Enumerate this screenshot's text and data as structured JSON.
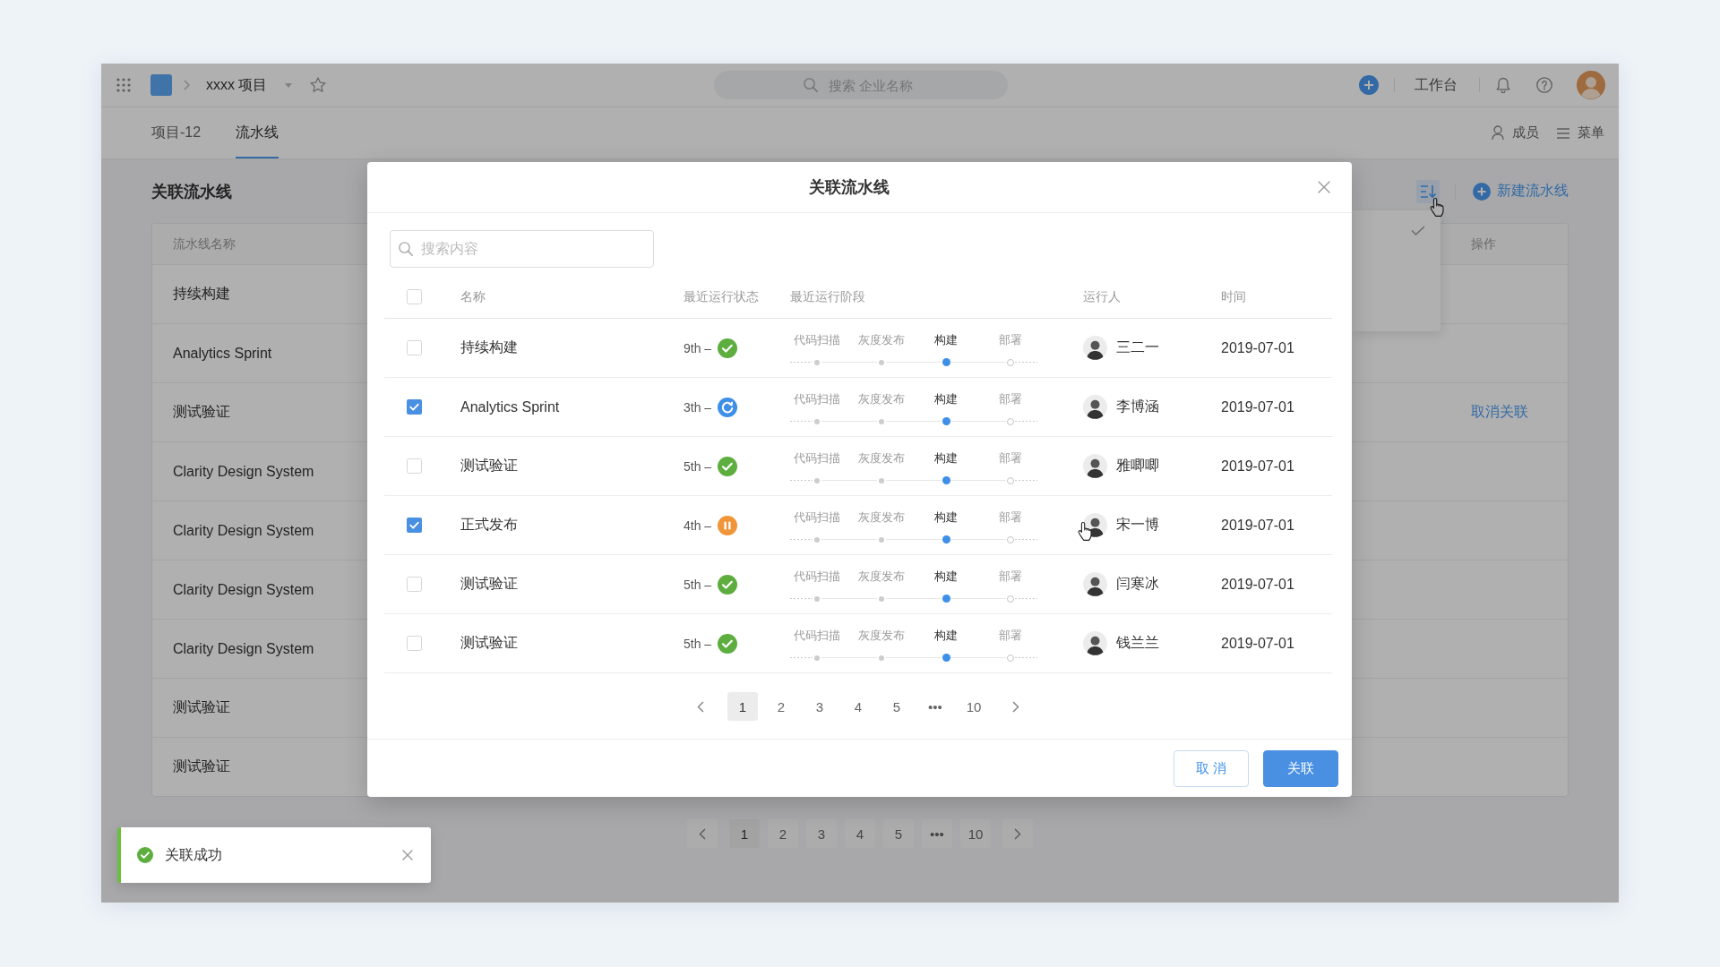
{
  "topbar": {
    "project": "xxxx 项目",
    "search": {
      "placeholder": "搜索 企业名称"
    },
    "workbench": "工作台"
  },
  "tabs": [
    {
      "label": "项目-12",
      "selected": false
    },
    {
      "label": "流水线",
      "selected": true
    }
  ],
  "header_actions": [
    {
      "kind": "members",
      "label": "成员"
    },
    {
      "kind": "menu",
      "label": "菜单"
    }
  ],
  "page": {
    "title": "关联流水线",
    "sort_button": {
      "active": true
    },
    "new_button": "新建流水线"
  },
  "sort_menu": {
    "items": [
      {
        "checked": true
      },
      {
        "checked": false
      },
      {
        "checked": false
      }
    ]
  },
  "pipeline_table": {
    "columns": [
      "流水线名称",
      "操作"
    ],
    "rows": [
      {
        "name": "持续构建"
      },
      {
        "name": "Analytics Sprint"
      },
      {
        "name": "测试验证",
        "action": "取消关联"
      },
      {
        "name": "Clarity Design System"
      },
      {
        "name": "Clarity Design System"
      },
      {
        "name": "Clarity Design System"
      },
      {
        "name": "Clarity Design System"
      },
      {
        "name": "测试验证"
      },
      {
        "name": "测试验证"
      }
    ]
  },
  "pagination": {
    "pages": [
      {
        "label": "1",
        "selected": true
      },
      {
        "label": "2",
        "selected": false
      },
      {
        "label": "3",
        "selected": false
      },
      {
        "label": "4",
        "selected": false
      },
      {
        "label": "5",
        "selected": false
      },
      {
        "label": "•••",
        "selected": false
      },
      {
        "label": "10",
        "selected": false
      }
    ]
  },
  "dialog": {
    "title": "关联流水线",
    "search": {
      "placeholder": "搜索内容"
    },
    "select_all": {
      "checked": false
    },
    "columns": [
      "名称",
      "最近运行状态",
      "最近运行阶段",
      "运行人",
      "时间"
    ],
    "rows": [
      {
        "checked": false,
        "name": "持续构建",
        "run": "9th –",
        "status": {
          "kind": "success"
        },
        "stages": [
          {
            "label": "代码扫描",
            "kind": "done"
          },
          {
            "label": "灰度发布",
            "kind": "done"
          },
          {
            "label": "构建",
            "kind": "current"
          },
          {
            "label": "部署",
            "kind": "pending"
          }
        ],
        "runner": "三二一",
        "time": "2019-07-01"
      },
      {
        "checked": true,
        "name": "Analytics Sprint",
        "run": "3th –",
        "status": {
          "kind": "running"
        },
        "stages": [
          {
            "label": "代码扫描",
            "kind": "done"
          },
          {
            "label": "灰度发布",
            "kind": "done"
          },
          {
            "label": "构建",
            "kind": "current"
          },
          {
            "label": "部署",
            "kind": "pending"
          }
        ],
        "runner": "李博涵",
        "time": "2019-07-01"
      },
      {
        "checked": false,
        "name": "测试验证",
        "run": "5th –",
        "status": {
          "kind": "success"
        },
        "stages": [
          {
            "label": "代码扫描",
            "kind": "done"
          },
          {
            "label": "灰度发布",
            "kind": "done"
          },
          {
            "label": "构建",
            "kind": "current"
          },
          {
            "label": "部署",
            "kind": "pending"
          }
        ],
        "runner": "雅唧唧",
        "time": "2019-07-01"
      },
      {
        "checked": true,
        "name": "正式发布",
        "run": "4th –",
        "status": {
          "kind": "paused"
        },
        "stages": [
          {
            "label": "代码扫描",
            "kind": "done"
          },
          {
            "label": "灰度发布",
            "kind": "done"
          },
          {
            "label": "构建",
            "kind": "current"
          },
          {
            "label": "部署",
            "kind": "pending"
          }
        ],
        "runner": "宋一博",
        "time": "2019-07-01"
      },
      {
        "checked": false,
        "name": "测试验证",
        "run": "5th –",
        "status": {
          "kind": "success"
        },
        "stages": [
          {
            "label": "代码扫描",
            "kind": "done"
          },
          {
            "label": "灰度发布",
            "kind": "done"
          },
          {
            "label": "构建",
            "kind": "current"
          },
          {
            "label": "部署",
            "kind": "pending"
          }
        ],
        "runner": "闫寒冰",
        "time": "2019-07-01"
      },
      {
        "checked": false,
        "name": "测试验证",
        "run": "5th –",
        "status": {
          "kind": "success"
        },
        "stages": [
          {
            "label": "代码扫描",
            "kind": "done"
          },
          {
            "label": "灰度发布",
            "kind": "done"
          },
          {
            "label": "构建",
            "kind": "current"
          },
          {
            "label": "部署",
            "kind": "pending"
          }
        ],
        "runner": "钱兰兰",
        "time": "2019-07-01"
      }
    ],
    "pagination": {
      "pages": [
        {
          "label": "1",
          "selected": true
        },
        {
          "label": "2",
          "selected": false
        },
        {
          "label": "3",
          "selected": false
        },
        {
          "label": "4",
          "selected": false
        },
        {
          "label": "5",
          "selected": false
        },
        {
          "label": "•••",
          "selected": false
        },
        {
          "label": "10",
          "selected": false
        }
      ]
    },
    "buttons": [
      {
        "kind": "secondary",
        "label": "取 消"
      },
      {
        "kind": "primary",
        "label": "关联"
      }
    ]
  },
  "toast": {
    "kind": "success",
    "message": "关联成功"
  }
}
